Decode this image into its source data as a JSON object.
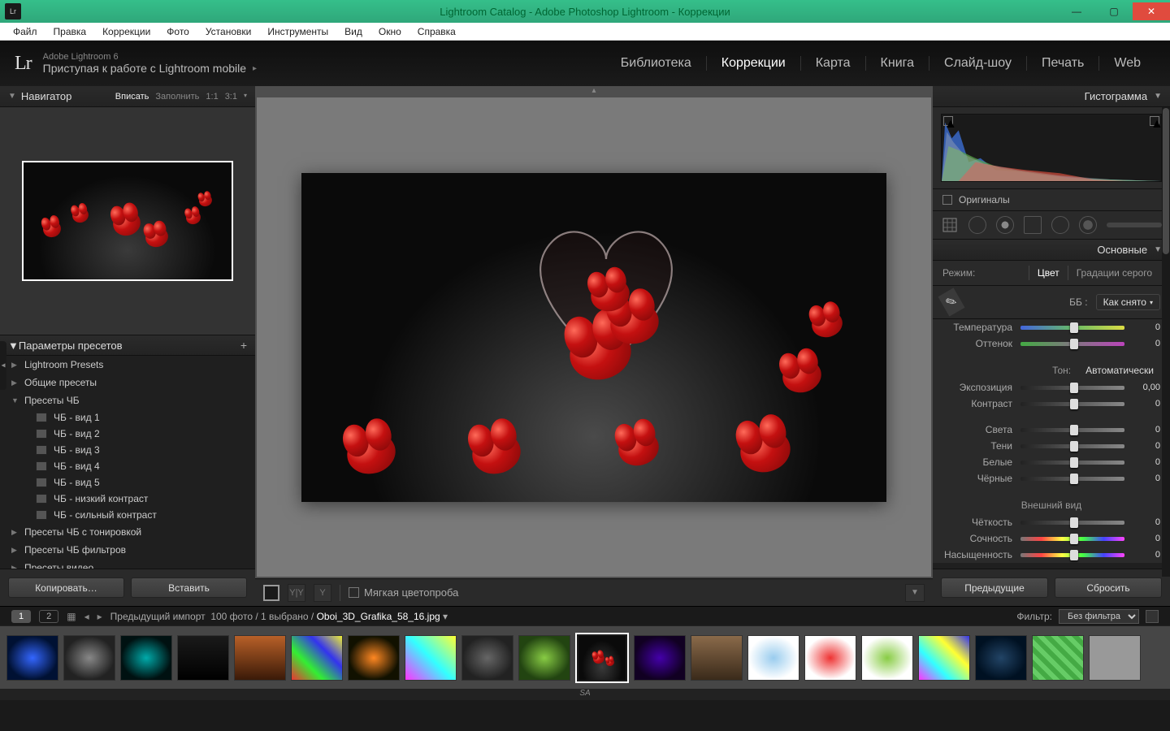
{
  "window": {
    "title": "Lightroom Catalog - Adobe Photoshop Lightroom - Коррекции",
    "icon": "Lr"
  },
  "menu": [
    "Файл",
    "Правка",
    "Коррекции",
    "Фото",
    "Установки",
    "Инструменты",
    "Вид",
    "Окно",
    "Справка"
  ],
  "header": {
    "logo": "Lr",
    "product": "Adobe Lightroom 6",
    "tagline": "Приступая к работе с Lightroom mobile",
    "modules": [
      "Библиотека",
      "Коррекции",
      "Карта",
      "Книга",
      "Слайд-шоу",
      "Печать",
      "Web"
    ],
    "active_module": "Коррекции"
  },
  "navigator": {
    "title": "Навигатор",
    "zoom": [
      "Вписать",
      "Заполнить",
      "1:1",
      "3:1"
    ],
    "zoom_selected": "Вписать"
  },
  "presets_panel": {
    "title": "Параметры пресетов",
    "groups": [
      {
        "label": "Lightroom Presets",
        "open": false
      },
      {
        "label": "Общие пресеты",
        "open": false
      },
      {
        "label": "Пресеты ЧБ",
        "open": true,
        "items": [
          "ЧБ - вид 1",
          "ЧБ - вид 2",
          "ЧБ - вид 3",
          "ЧБ - вид 4",
          "ЧБ - вид 5",
          "ЧБ - низкий контраст",
          "ЧБ - сильный контраст"
        ]
      },
      {
        "label": "Пресеты ЧБ с тонировкой",
        "open": false
      },
      {
        "label": "Пресеты ЧБ фильтров",
        "open": false
      },
      {
        "label": "Пресеты видео",
        "open": false
      }
    ]
  },
  "left_buttons": {
    "copy": "Копировать…",
    "paste": "Вставить"
  },
  "softproof": {
    "label": "Мягкая цветопроба"
  },
  "right": {
    "histogram": "Гистограмма",
    "originals": "Оригиналы",
    "basic": "Основные",
    "mode_label": "Режим:",
    "mode_color": "Цвет",
    "mode_gray": "Градации серого",
    "wb_label": "ББ :",
    "wb_value": "Как снято",
    "tone_label": "Тон:",
    "tone_auto": "Автоматически",
    "appearance": "Внешний вид",
    "sliders": {
      "temperature": {
        "label": "Температура",
        "value": "0"
      },
      "tint": {
        "label": "Оттенок",
        "value": "0"
      },
      "exposure": {
        "label": "Экспозиция",
        "value": "0,00"
      },
      "contrast": {
        "label": "Контраст",
        "value": "0"
      },
      "highlights": {
        "label": "Света",
        "value": "0"
      },
      "shadows": {
        "label": "Тени",
        "value": "0"
      },
      "whites": {
        "label": "Белые",
        "value": "0"
      },
      "blacks": {
        "label": "Чёрные",
        "value": "0"
      },
      "clarity": {
        "label": "Чёткость",
        "value": "0"
      },
      "vibrance": {
        "label": "Сочность",
        "value": "0"
      },
      "saturation": {
        "label": "Насыщенность",
        "value": "0"
      }
    },
    "prev_button": "Предыдущие",
    "reset_button": "Сбросить"
  },
  "strip": {
    "pages": [
      "1",
      "2"
    ],
    "info_prefix": "Предыдущий импорт",
    "count": "100 фото",
    "selected": "1 выбрано",
    "filename": "Oboi_3D_Grafika_58_16.jpg",
    "filter_label": "Фильтр:",
    "filter_value": "Без фильтра"
  },
  "footer": "SA"
}
